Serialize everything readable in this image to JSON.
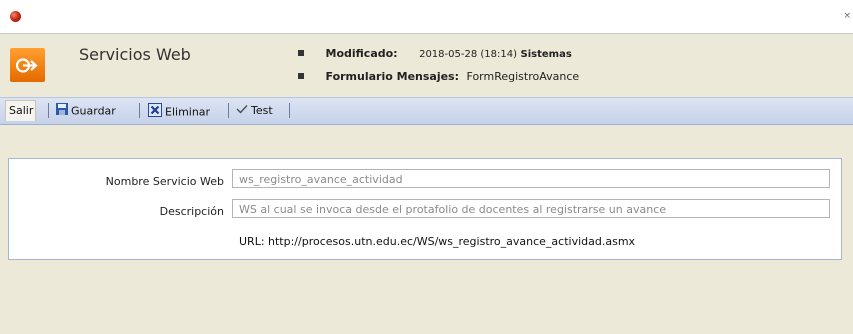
{
  "window": {
    "close_glyph": "×"
  },
  "header": {
    "title": "Servicios Web",
    "modificado_label": "Modificado:",
    "modificado_value": "2018-05-28 (18:14)",
    "modificado_user": "Sistemas",
    "formulario_label": "Formulario Mensajes:",
    "formulario_value": "FormRegistroAvance",
    "logo_icon": "exit-arrow-icon",
    "logo_color": "#F57F0F"
  },
  "toolbar": {
    "salir_label": "Salir",
    "guardar_label": "Guardar",
    "eliminar_label": "Eliminar",
    "test_label": "Test",
    "guardar_icon": "floppy-disk-icon",
    "eliminar_icon": "delete-x-icon",
    "test_icon": "checkmark-icon"
  },
  "form": {
    "nombre_label": "Nombre Servicio Web",
    "nombre_value": "ws_registro_avance_actividad",
    "descripcion_label": "Descripción",
    "descripcion_value": "WS al cual se invoca desde el protafolio de docentes al registrarse un avance",
    "url_text": "URL: http://procesos.utn.edu.ec/WS/ws_registro_avance_actividad.asmx"
  }
}
